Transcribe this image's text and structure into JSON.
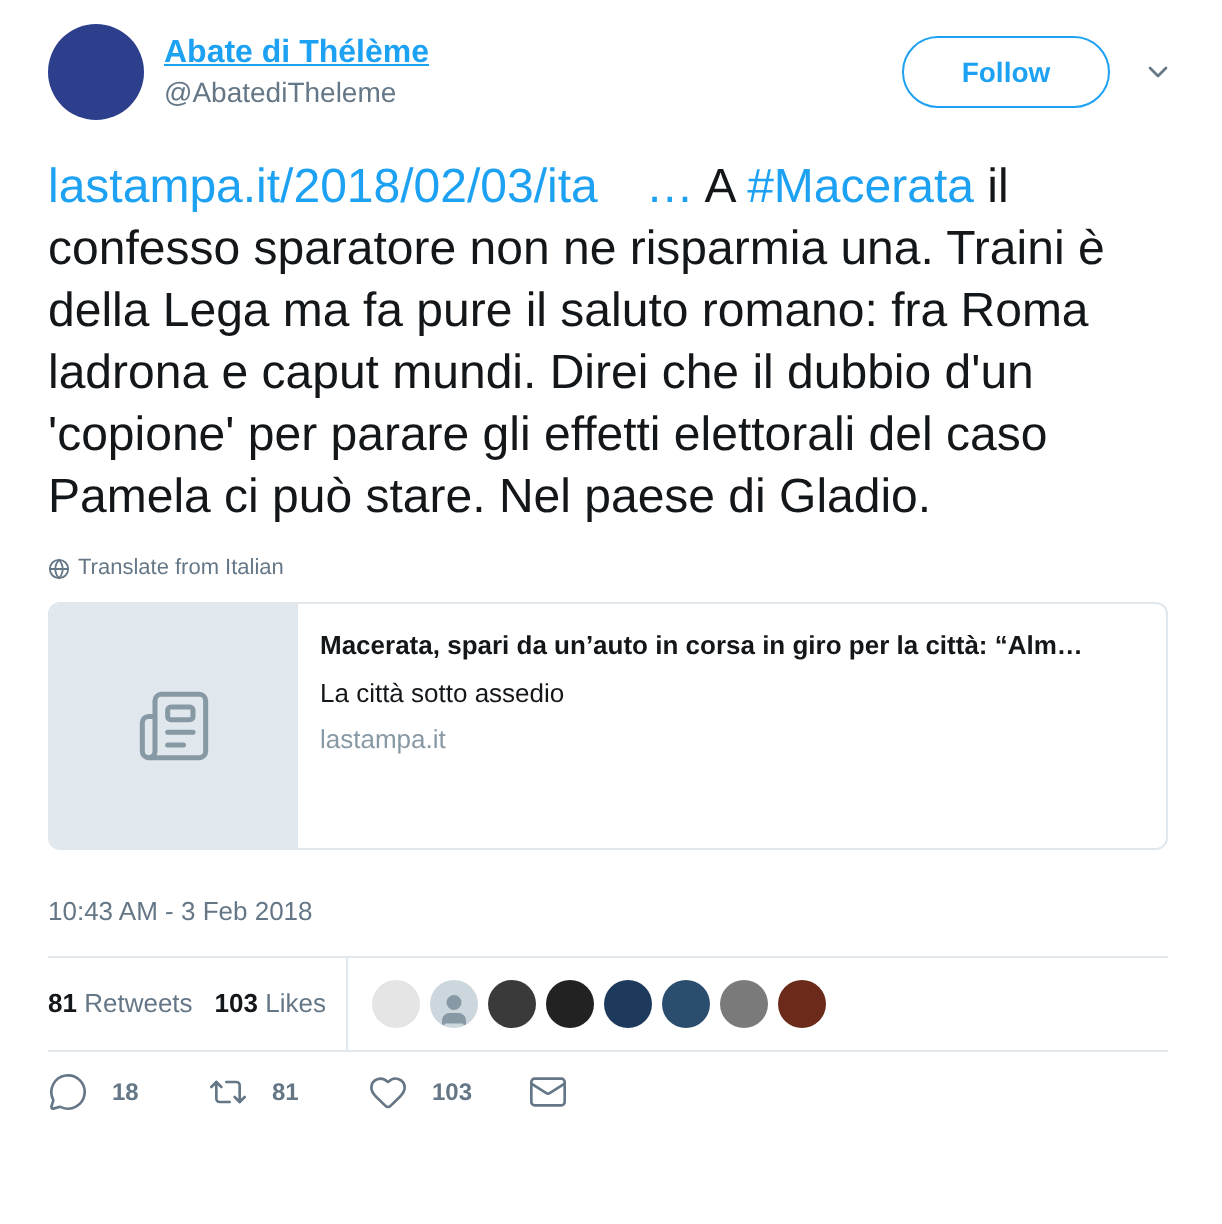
{
  "author": {
    "name": "Abate di Thélème",
    "handle": "@AbatediTheleme"
  },
  "follow_button": "Follow",
  "tweet": [
    {
      "kind": "link",
      "text": "lastampa.it/2018/02/03/ita"
    },
    {
      "kind": "link-ellipsis",
      "text": "…"
    },
    {
      "kind": "text",
      "text": " A "
    },
    {
      "kind": "hashtag",
      "text": "#Macerata"
    },
    {
      "kind": "text",
      "text": " il confesso sparatore non ne risparmia una. Traini è della Lega ma fa pure il saluto romano: fra Roma ladrona e caput mundi. Direi che il dubbio d'un 'copione' per parare gli effetti elettorali del caso Pamela ci può stare. Nel paese di Gladio."
    }
  ],
  "translate": "Translate from Italian",
  "card": {
    "title": "Macerata, spari da un’auto in corsa in giro per la città: “Alm…",
    "description": "La città sotto assedio",
    "domain": "lastampa.it"
  },
  "timestamp": "10:43 AM - 3 Feb 2018",
  "stats": [
    {
      "count": "81",
      "label": "Retweets"
    },
    {
      "count": "103",
      "label": "Likes"
    }
  ],
  "likers": [
    {
      "kind": "photo"
    },
    {
      "kind": "default"
    },
    {
      "kind": "photo"
    },
    {
      "kind": "photo"
    },
    {
      "kind": "photo"
    },
    {
      "kind": "photo"
    },
    {
      "kind": "photo"
    },
    {
      "kind": "photo"
    }
  ],
  "actions": [
    {
      "kind": "reply",
      "count": "18"
    },
    {
      "kind": "retweet",
      "count": "81"
    },
    {
      "kind": "like",
      "count": "103"
    },
    {
      "kind": "message"
    }
  ]
}
